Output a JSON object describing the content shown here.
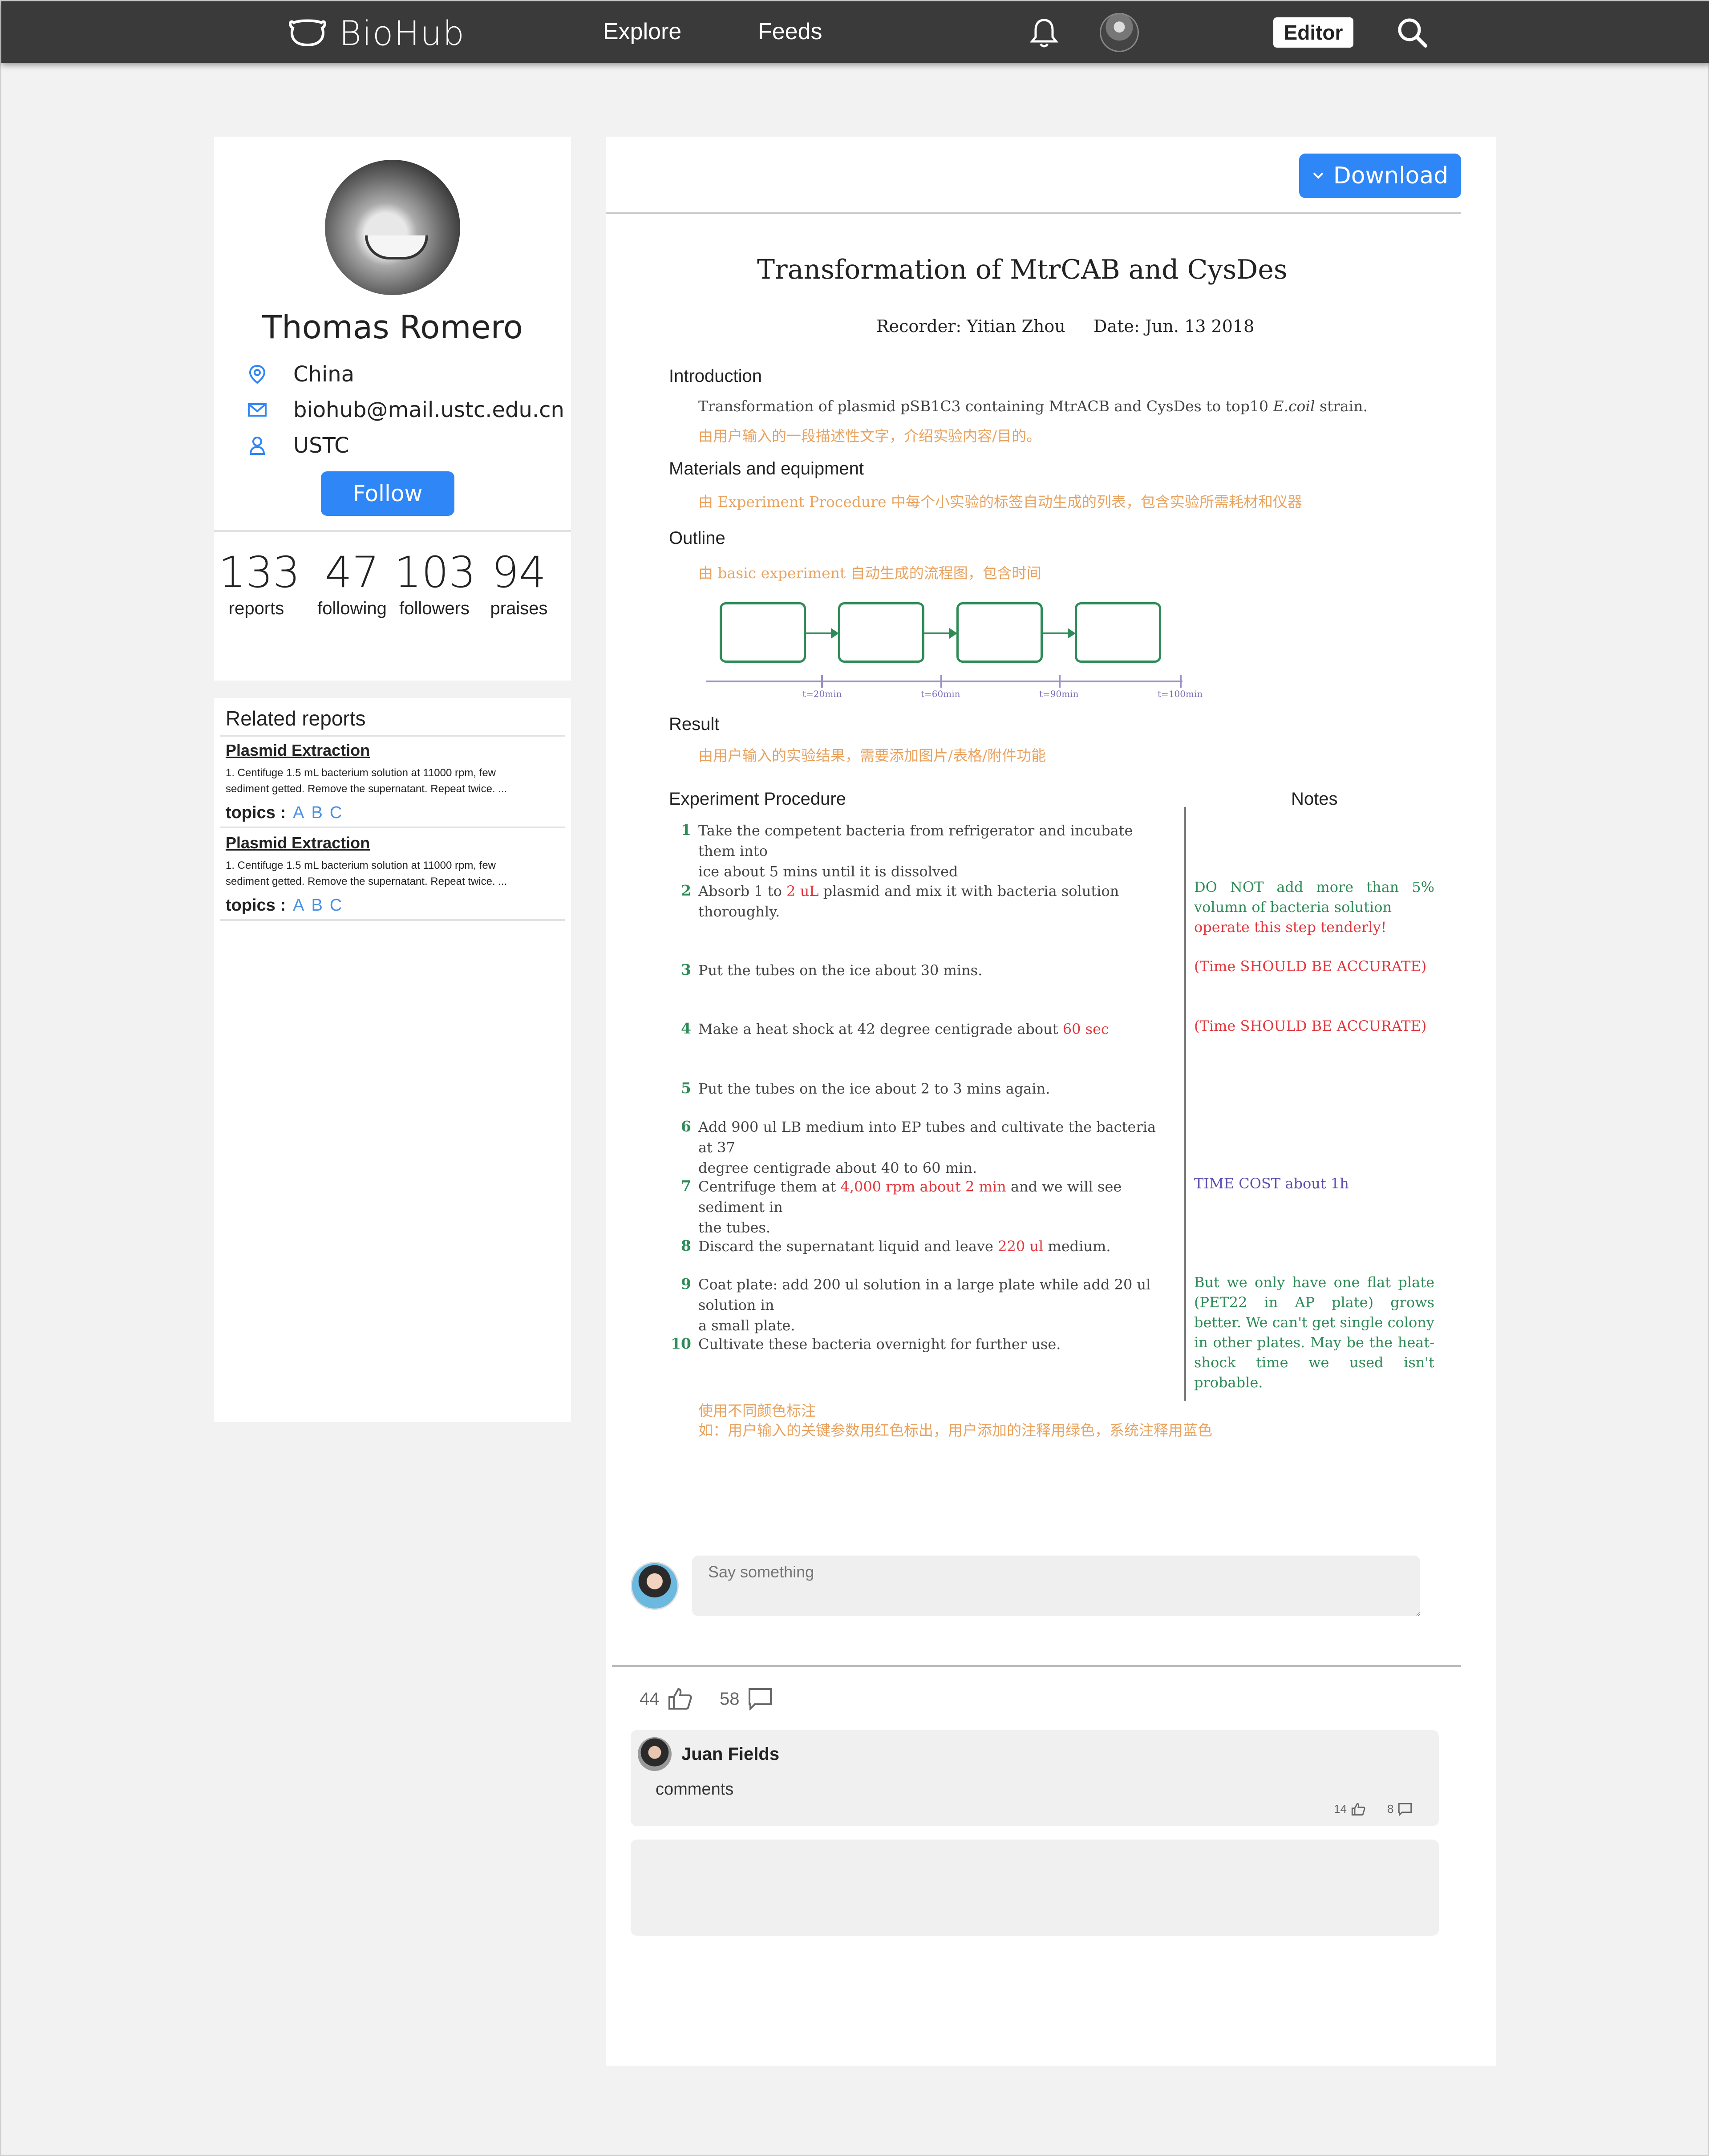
{
  "nav": {
    "brand": "BioHub",
    "links": [
      "Explore",
      "Feeds"
    ],
    "editor_label": "Editor"
  },
  "profile": {
    "name": "Thomas Romero",
    "location": "China",
    "email": "biohub@mail.ustc.edu.cn",
    "organization": "USTC",
    "follow_label": "Follow",
    "stats": [
      {
        "value": "133",
        "label": "reports"
      },
      {
        "value": "47",
        "label": "following"
      },
      {
        "value": "103",
        "label": "followers"
      },
      {
        "value": "94",
        "label": "praises"
      }
    ]
  },
  "related": {
    "title": "Related reports",
    "items": [
      {
        "title": "Plasmid Extraction",
        "text_line1": "1. Centifuge 1.5 mL bacterium solution at 11000 rpm, few",
        "text_line2": "sediment getted. Remove the supernatant. Repeat twice. ...",
        "topics_label": "topics :",
        "topics": [
          "A",
          "B",
          "C"
        ]
      },
      {
        "title": "Plasmid Extraction",
        "text_line1": "1. Centifuge 1.5 mL bacterium solution at 11000 rpm, few",
        "text_line2": "sediment getted. Remove the supernatant. Repeat twice. ...",
        "topics_label": "topics :",
        "topics": [
          "A",
          "B",
          "C"
        ]
      }
    ]
  },
  "report": {
    "download_label": "Download",
    "title": "Transformation of MtrCAB and CysDes",
    "recorder": "Recorder: Yitian Zhou",
    "date": "Date: Jun. 13 2018",
    "introduction": {
      "heading": "Introduction",
      "text_before": "Transformation of plasmid pSB1C3 containing MtrACB and CysDes to top10 ",
      "text_italic": "E.coil",
      "text_after": " strain.",
      "note_cn": "由用户输入的一段描述性文字，介绍实验内容/目的。"
    },
    "materials": {
      "heading": "Materials and equipment",
      "note_cn": "由 Experiment Procedure 中每个小实验的标签自动生成的列表，包含实验所需耗材和仪器"
    },
    "outline": {
      "heading": "Outline",
      "note_cn": "由 basic experiment 自动生成的流程图，包含时间",
      "ticks": [
        "t=20min",
        "t=60min",
        "t=90min",
        "t=100min"
      ]
    },
    "result": {
      "heading": "Result",
      "note_cn": "由用户输入的实验结果，需要添加图片/表格/附件功能"
    },
    "procedure": {
      "heading": "Experiment Procedure",
      "notes_heading": "Notes",
      "steps": [
        {
          "n": "1",
          "l1": "Take the competent bacteria from refrigerator and incubate them into",
          "l2": "ice about 5 mins until it is dissolved"
        },
        {
          "n": "2",
          "a": "Absorb 1 to ",
          "b": "2 uL",
          "c": " plasmid and mix it with bacteria solution thoroughly."
        },
        {
          "n": "3",
          "l1": "Put the tubes on the ice about 30 mins."
        },
        {
          "n": "4",
          "a": "Make a heat shock at 42 degree centigrade about ",
          "b": "60 sec",
          "c": ""
        },
        {
          "n": "5",
          "l1": "Put the tubes on the ice about 2 to 3 mins again."
        },
        {
          "n": "6",
          "l1": "Add 900 ul LB medium into EP tubes and cultivate the bacteria at 37",
          "l2": "degree centigrade about 40 to 60 min."
        },
        {
          "n": "7",
          "a": "Centrifuge them at ",
          "b": "4,000 rpm about 2 min",
          "c": " and we will see sediment in",
          "l2": "the tubes."
        },
        {
          "n": "8",
          "a": "Discard the supernatant liquid and leave ",
          "b": "220 ul",
          "c": " medium."
        },
        {
          "n": "9",
          "l1": "Coat plate: add 200 ul solution in a large plate while add 20 ul solution in",
          "l2": "a small plate."
        },
        {
          "n": "10",
          "l1": "Cultivate these bacteria overnight for further use."
        }
      ],
      "notes": {
        "n2_green": "DO NOT add more than 5% volumn of bacteria solution",
        "n2_red": "operate this step tenderly!",
        "n3": "(Time SHOULD BE ACCURATE)",
        "n4": "(Time SHOULD BE ACCURATE)",
        "n7": "TIME COST about 1h",
        "n9": "But we only have one flat plate (PET22 in AP plate) grows better. We can't get single colony in other plates. May be the heat-shock time we used isn't probable."
      },
      "color_note_line1": "使用不同颜色标注",
      "color_note_line2": "如：用户输入的关键参数用红色标出，用户添加的注释用绿色，系统注释用蓝色"
    }
  },
  "comments": {
    "placeholder": "Say something",
    "likes": "44",
    "replies": "58",
    "items": [
      {
        "author": "Juan Fields",
        "text": "comments",
        "likes": "14",
        "replies": "8"
      }
    ]
  },
  "colors": {
    "accent": "#2f86f6",
    "nav_bg": "#3a3a3a",
    "param_red": "#e0353b",
    "user_note_green": "#2e8b57",
    "system_note_blue": "#5a4fb0",
    "cn_orange": "#e9a35f"
  }
}
